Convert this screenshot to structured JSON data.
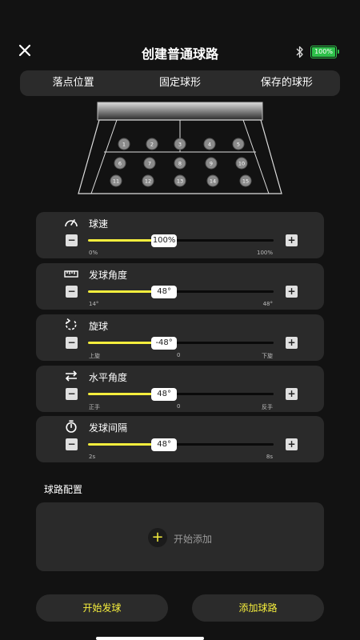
{
  "header": {
    "title": "创建普通球路",
    "battery_label": "100%"
  },
  "tabs": [
    {
      "label": "落点位置"
    },
    {
      "label": "固定球形"
    },
    {
      "label": "保存的球形"
    }
  ],
  "court": {
    "spots": [
      "1",
      "2",
      "3",
      "4",
      "5",
      "6",
      "7",
      "8",
      "9",
      "10",
      "11",
      "12",
      "13",
      "14",
      "15"
    ]
  },
  "controls": [
    {
      "label": "球速",
      "icon": "speedometer-icon",
      "value_text": "100%",
      "level": 0.41,
      "min_label": "0%",
      "mid_label": "",
      "max_label": "100%"
    },
    {
      "label": "发球角度",
      "icon": "ruler-icon",
      "value_text": "48°",
      "level": 0.41,
      "min_label": "14°",
      "mid_label": "",
      "max_label": "48°"
    },
    {
      "label": "旋球",
      "icon": "rotate-icon",
      "value_text": "-48°",
      "level": 0.41,
      "min_label": "上旋",
      "mid_label": "0",
      "max_label": "下旋"
    },
    {
      "label": "水平角度",
      "icon": "swap-arrows-icon",
      "value_text": "48°",
      "level": 0.41,
      "min_label": "正手",
      "mid_label": "0",
      "max_label": "反手"
    },
    {
      "label": "发球间隔",
      "icon": "timer-icon",
      "value_text": "48°",
      "level": 0.41,
      "min_label": "2s",
      "mid_label": "",
      "max_label": "8s"
    }
  ],
  "config": {
    "title": "球路配置",
    "add_label": "开始添加"
  },
  "buttons": {
    "start_label": "开始发球",
    "add_route_label": "添加球路"
  },
  "colors": {
    "accent": "#f5ee3d",
    "background": "#121212",
    "card": "#2a2a2a",
    "battery": "#2ec24a"
  }
}
